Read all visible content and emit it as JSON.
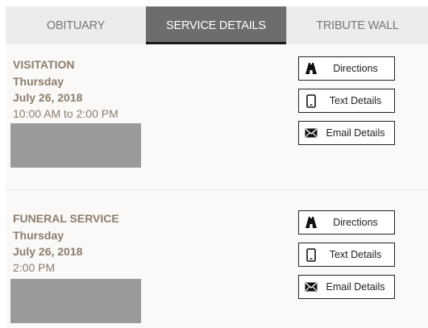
{
  "tabs": [
    {
      "label": "OBITUARY",
      "active": false
    },
    {
      "label": "SERVICE DETAILS",
      "active": true
    },
    {
      "label": "TRIBUTE WALL",
      "active": false
    }
  ],
  "events": [
    {
      "title": "VISITATION",
      "day": "Thursday",
      "date": "July 26, 2018",
      "time": "10:00 AM to 2:00 PM",
      "buttons": {
        "directions": "Directions",
        "text": "Text Details",
        "email": "Email Details"
      }
    },
    {
      "title": "FUNERAL SERVICE",
      "day": "Thursday",
      "date": "July 26, 2018",
      "time": "2:00 PM",
      "buttons": {
        "directions": "Directions",
        "text": "Text Details",
        "email": "Email Details"
      }
    }
  ],
  "colors": {
    "event_text": "#8a7d6e",
    "active_tab": "#6d6d6d",
    "inactive_tab": "#ececec",
    "placeholder_box": "#9a9a9a"
  },
  "icons": {
    "directions": "road-icon",
    "text": "phone-icon",
    "email": "envelope-icon"
  }
}
